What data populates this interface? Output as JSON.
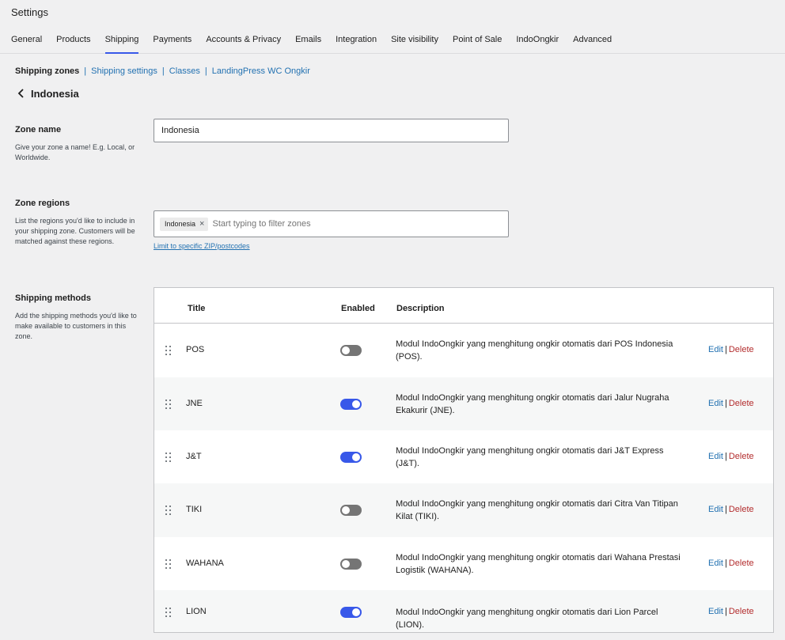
{
  "header": {
    "title": "Settings",
    "tabs": [
      {
        "label": "General"
      },
      {
        "label": "Products"
      },
      {
        "label": "Shipping"
      },
      {
        "label": "Payments"
      },
      {
        "label": "Accounts & Privacy"
      },
      {
        "label": "Emails"
      },
      {
        "label": "Integration"
      },
      {
        "label": "Site visibility"
      },
      {
        "label": "Point of Sale"
      },
      {
        "label": "IndoOngkir"
      },
      {
        "label": "Advanced"
      }
    ],
    "active_tab": "Shipping"
  },
  "subnav": {
    "current": "Shipping zones",
    "separator": "|",
    "links": [
      "Shipping settings",
      "Classes",
      "LandingPress WC Ongkir"
    ]
  },
  "zone": {
    "title": "Indonesia"
  },
  "zone_name": {
    "label": "Zone name",
    "help": "Give your zone a name! E.g. Local, or Worldwide.",
    "value": "Indonesia"
  },
  "zone_regions": {
    "label": "Zone regions",
    "help": "List the regions you'd like to include in your shipping zone. Customers will be matched against these regions.",
    "chip": "Indonesia",
    "chip_remove": "×",
    "placeholder": "Start typing to filter zones",
    "zip_link": "Limit to specific ZIP/postcodes"
  },
  "shipping_methods": {
    "label": "Shipping methods",
    "help": "Add the shipping methods you'd like to make available to customers in this zone.",
    "columns": {
      "title": "Title",
      "enabled": "Enabled",
      "description": "Description"
    },
    "edit_label": "Edit",
    "action_separator": "|",
    "delete_label": "Delete",
    "rows": [
      {
        "title": "POS",
        "enabled": false,
        "description": "Modul IndoOngkir yang menghitung ongkir otomatis dari POS Indonesia (POS)."
      },
      {
        "title": "JNE",
        "enabled": true,
        "description": "Modul IndoOngkir yang menghitung ongkir otomatis dari Jalur Nugraha Ekakurir (JNE)."
      },
      {
        "title": "J&T",
        "enabled": true,
        "description": "Modul IndoOngkir yang menghitung ongkir otomatis dari J&T Express (J&T)."
      },
      {
        "title": "TIKI",
        "enabled": false,
        "description": "Modul IndoOngkir yang menghitung ongkir otomatis dari Citra Van Titipan Kilat (TIKI)."
      },
      {
        "title": "WAHANA",
        "enabled": false,
        "description": "Modul IndoOngkir yang menghitung ongkir otomatis dari Wahana Prestasi Logistik (WAHANA)."
      },
      {
        "title": "LION",
        "enabled": true,
        "description": "Modul IndoOngkir yang menghitung ongkir otomatis dari Lion Parcel (LION)."
      }
    ]
  },
  "colors": {
    "accent": "#3858e9",
    "link": "#2271b1",
    "delete": "#b32d2e",
    "toggle_off": "#757575",
    "background": "#f0f0f1"
  },
  "icons": {
    "back": "chevron-left-icon",
    "drag": "drag-handle-icon",
    "remove_chip": "close-icon"
  }
}
